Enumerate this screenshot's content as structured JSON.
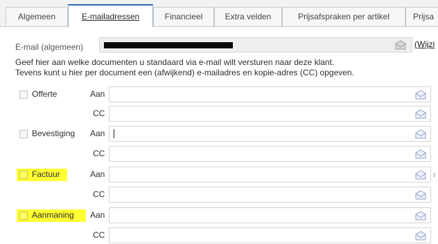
{
  "tabs": [
    {
      "label": "Algemeen",
      "active": false
    },
    {
      "label": "E-mailadressen",
      "active": true
    },
    {
      "label": "Financieel",
      "active": false
    },
    {
      "label": "Extra velden",
      "active": false
    },
    {
      "label": "Prijsafspraken per artikel",
      "active": false
    },
    {
      "label": "Prijsa",
      "active": false
    }
  ],
  "email": {
    "label": "E-mail (algemeen)",
    "wijzig": "(Wijzi"
  },
  "info": {
    "line1": "Geef hier aan welke documenten u standaard via e-mail wilt versturen naar deze klant.",
    "line2": "Tevens kunt u hier per document een (afwijkend) e-mailadres en kopie-adres (CC) opgeven."
  },
  "labels": {
    "to": "Aan",
    "cc": "CC"
  },
  "documents": [
    {
      "name": "Offerte",
      "checked": false,
      "highlighted": false,
      "to": "",
      "cc": ""
    },
    {
      "name": "Bevestiging",
      "checked": false,
      "highlighted": false,
      "to": "",
      "cc": ""
    },
    {
      "name": "Factuur",
      "checked": false,
      "highlighted": true,
      "to": "",
      "cc": ""
    },
    {
      "name": "Aanmaning",
      "checked": false,
      "highlighted": true,
      "to": "",
      "cc": ""
    }
  ],
  "colors": {
    "highlight": "#ffff33",
    "active_tab_accent": "#2b6cb0",
    "envelope": "#9aa9c8"
  },
  "icons": {
    "send_email": "envelope-icon"
  }
}
